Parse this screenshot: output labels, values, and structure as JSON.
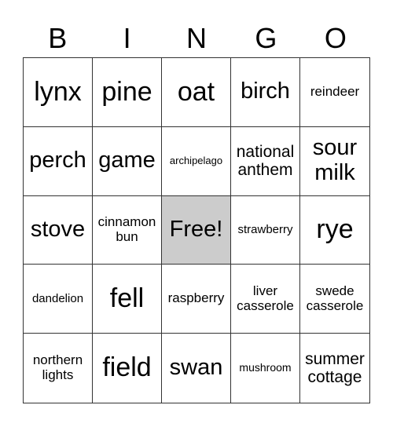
{
  "header": {
    "letters": [
      "B",
      "I",
      "N",
      "G",
      "O"
    ]
  },
  "colors": {
    "free_cell": "#cccccc",
    "grid_line": "#333333"
  },
  "grid": {
    "rows": [
      [
        "lynx",
        "pine",
        "oat",
        "birch",
        "reindeer"
      ],
      [
        "perch",
        "game",
        "archipelago",
        "national anthem",
        "sour milk"
      ],
      [
        "stove",
        "cinnamon bun",
        "Free!",
        "strawberry",
        "rye"
      ],
      [
        "dandelion",
        "fell",
        "raspberry",
        "liver casserole",
        "swede casserole"
      ],
      [
        "northern lights",
        "field",
        "swan",
        "mushroom",
        "summer cottage"
      ]
    ]
  }
}
